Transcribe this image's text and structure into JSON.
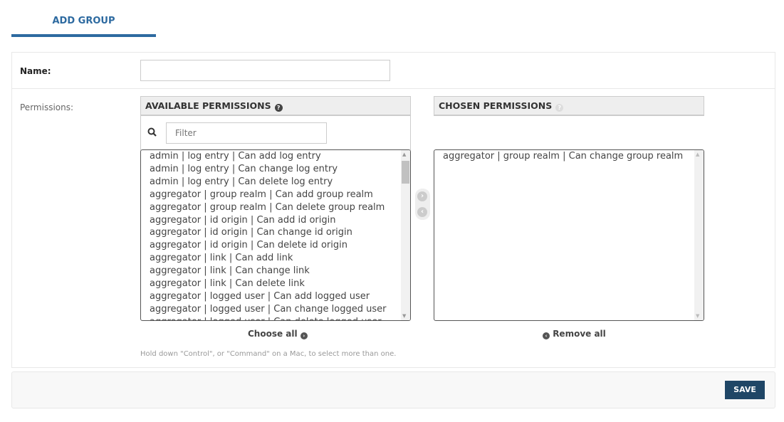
{
  "tab": {
    "label": "ADD GROUP"
  },
  "form": {
    "name_label": "Name:",
    "name_value": "",
    "permissions_label": "Permissions:",
    "available": {
      "title": "AVAILABLE PERMISSIONS",
      "help_icon": "question-circle-icon",
      "filter_placeholder": "Filter",
      "items": [
        "admin | log entry | Can add log entry",
        "admin | log entry | Can change log entry",
        "admin | log entry | Can delete log entry",
        "aggregator | group realm | Can add group realm",
        "aggregator | group realm | Can delete group realm",
        "aggregator | id origin | Can add id origin",
        "aggregator | id origin | Can change id origin",
        "aggregator | id origin | Can delete id origin",
        "aggregator | link | Can add link",
        "aggregator | link | Can change link",
        "aggregator | link | Can delete link",
        "aggregator | logged user | Can add logged user",
        "aggregator | logged user | Can change logged user",
        "aggregator | logged user | Can delete logged user"
      ],
      "choose_all": "Choose all"
    },
    "chosen": {
      "title": "CHOSEN PERMISSIONS",
      "items": [
        "aggregator | group realm | Can change group realm"
      ],
      "remove_all": "Remove all"
    },
    "help_text": "Hold down \"Control\", or \"Command\" on a Mac, to select more than one."
  },
  "footer": {
    "save_label": "SAVE"
  },
  "colors": {
    "accent": "#2d6aa0",
    "save_button": "#1f4666"
  }
}
